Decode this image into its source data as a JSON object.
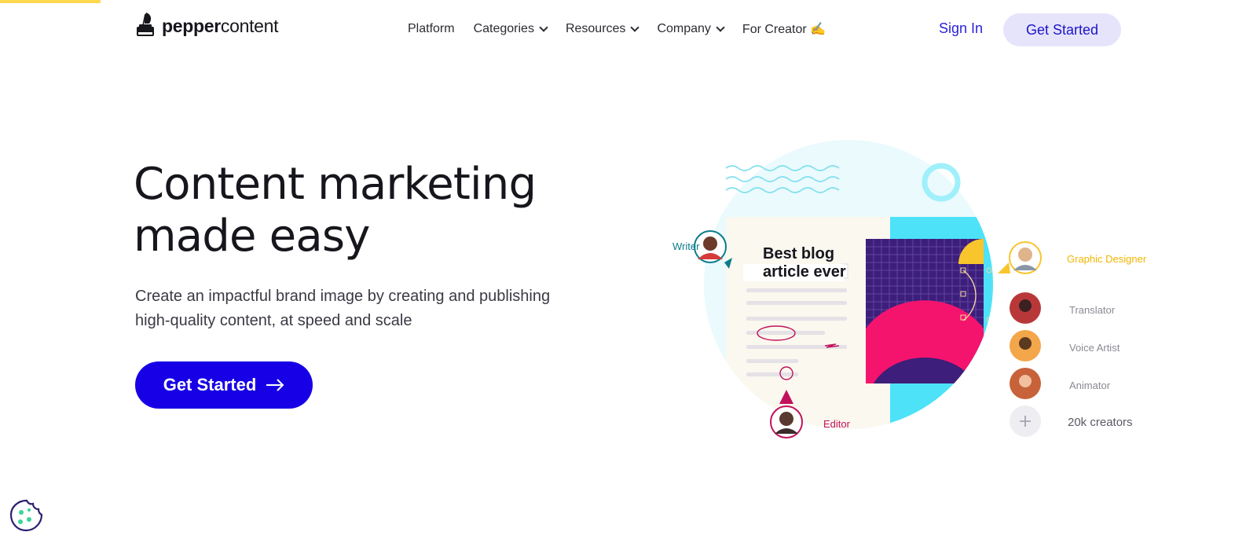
{
  "brand": {
    "logo_text_bold": "pepper",
    "logo_text_light": "content"
  },
  "nav": {
    "items": [
      {
        "label": "Platform",
        "has_dropdown": false
      },
      {
        "label": "Categories",
        "has_dropdown": true
      },
      {
        "label": "Resources",
        "has_dropdown": true
      },
      {
        "label": "Company",
        "has_dropdown": true
      },
      {
        "label": "For Creator ✍",
        "has_dropdown": false
      }
    ],
    "sign_in": "Sign In",
    "get_started": "Get Started"
  },
  "hero": {
    "title_line1": "Content marketing",
    "title_line2": "made easy",
    "subtitle_line1": "Create an impactful brand image by creating and publishing",
    "subtitle_line2": "high-quality content, at speed and scale",
    "cta": "Get Started"
  },
  "illustration": {
    "blog_line1": "Best blog",
    "blog_line2": "article ever",
    "roles": {
      "writer": "Writer",
      "editor": "Editor",
      "graphic_designer": "Graphic Designer",
      "translator": "Translator",
      "voice_artist": "Voice Artist",
      "animator": "Animator",
      "creators": "20k creators"
    }
  },
  "colors": {
    "primary": "#1700e6",
    "accent_light": "#e6e4fb",
    "writer": "#0b7c8a",
    "editor": "#c2125c",
    "designer": "#f2b600"
  },
  "icons": [
    "quill-ink-logo-icon",
    "chevron-down-icon",
    "arrow-right-icon",
    "plus-icon",
    "cookie-icon"
  ]
}
